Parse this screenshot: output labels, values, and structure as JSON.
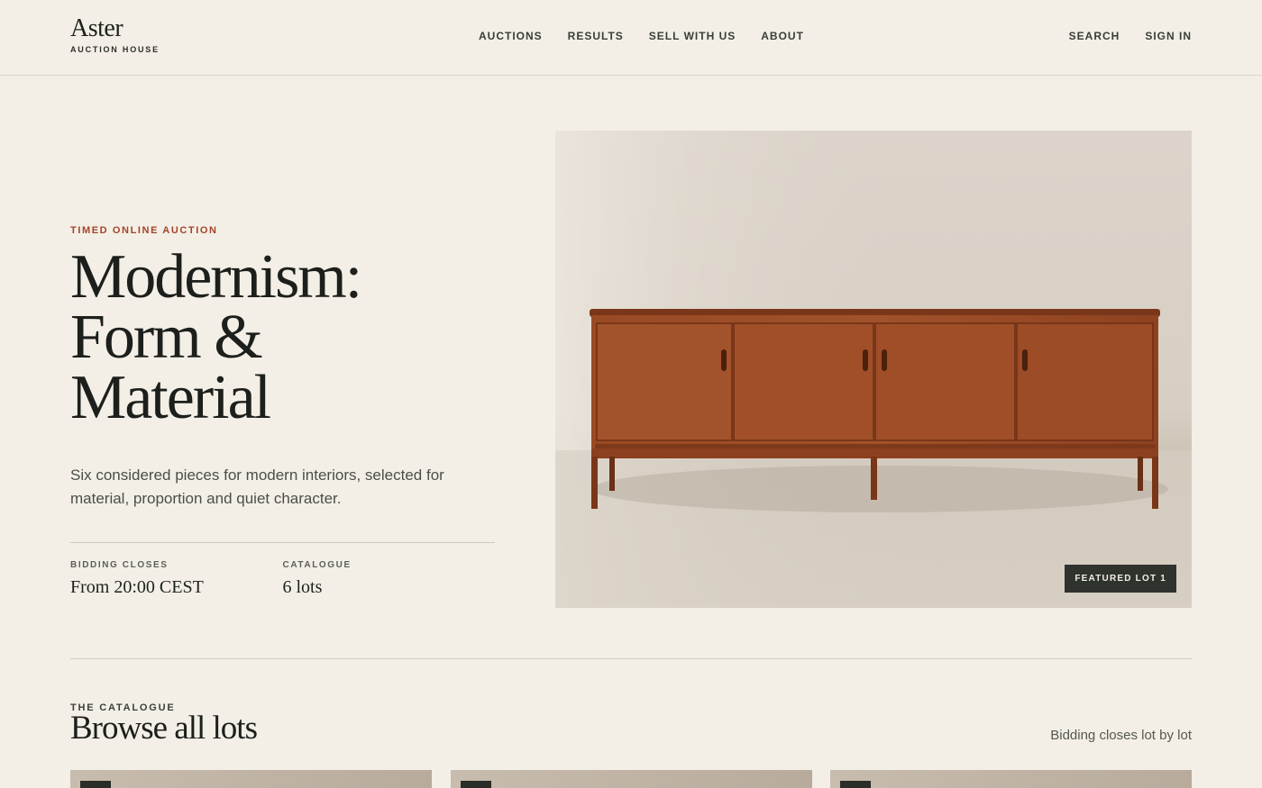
{
  "brand": {
    "name": "Aster",
    "subtitle": "AUCTION HOUSE"
  },
  "nav": [
    {
      "label": "AUCTIONS"
    },
    {
      "label": "RESULTS"
    },
    {
      "label": "SELL WITH US"
    },
    {
      "label": "ABOUT"
    }
  ],
  "utility": {
    "search": "SEARCH",
    "sign_in": "SIGN IN"
  },
  "hero": {
    "eyebrow": "TIMED ONLINE AUCTION",
    "title_lines": [
      "Modernism:",
      "Form &",
      "Material"
    ],
    "description": "Six considered pieces for modern interiors, selected for material, proportion and quiet character.",
    "facts": [
      {
        "label": "BIDDING CLOSES",
        "value": "From 20:00 CEST"
      },
      {
        "label": "CATALOGUE",
        "value": "6 lots"
      }
    ],
    "featured_badge": "FEATURED LOT 1"
  },
  "catalogue": {
    "eyebrow": "THE CATALOGUE",
    "title": "Browse all lots",
    "note": "Bidding closes lot by lot"
  },
  "colors": {
    "background": "#f3efe6",
    "accent": "#a4432a",
    "ink": "#1e211d",
    "badge": "#2f332e"
  }
}
